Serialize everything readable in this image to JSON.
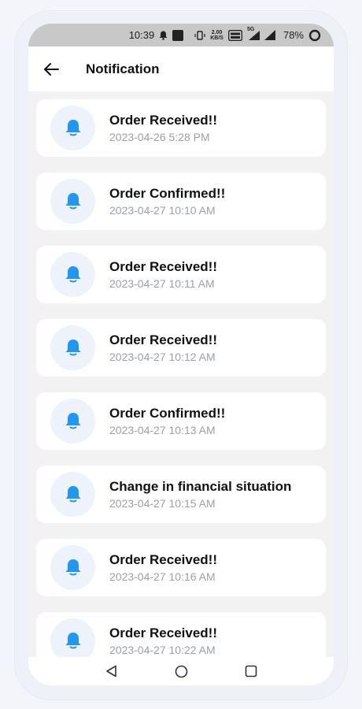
{
  "status_bar": {
    "time": "10:39",
    "speed_top": "2.00",
    "speed_bottom": "KB/S",
    "network_label": "5G",
    "battery": "78%"
  },
  "header": {
    "title": "Notification"
  },
  "colors": {
    "accent": "#2196F3",
    "icon_bg": "#EDF2FB",
    "muted_text": "#9AA0A8"
  },
  "notifications": [
    {
      "title": "Order Received!!",
      "time": "2023-04-26 5:28 PM",
      "icon": "bell-icon"
    },
    {
      "title": "Order Confirmed!!",
      "time": "2023-04-27 10:10 AM",
      "icon": "bell-icon"
    },
    {
      "title": "Order Received!!",
      "time": "2023-04-27 10:11 AM",
      "icon": "bell-icon"
    },
    {
      "title": "Order Received!!",
      "time": "2023-04-27 10:12 AM",
      "icon": "bell-icon"
    },
    {
      "title": "Order Confirmed!!",
      "time": "2023-04-27 10:13 AM",
      "icon": "bell-icon"
    },
    {
      "title": "Change in financial situation",
      "time": "2023-04-27 10:15 AM",
      "icon": "bell-icon"
    },
    {
      "title": "Order Received!!",
      "time": "2023-04-27 10:16 AM",
      "icon": "bell-icon"
    },
    {
      "title": "Order Received!!",
      "time": "2023-04-27 10:22 AM",
      "icon": "bell-icon"
    }
  ]
}
